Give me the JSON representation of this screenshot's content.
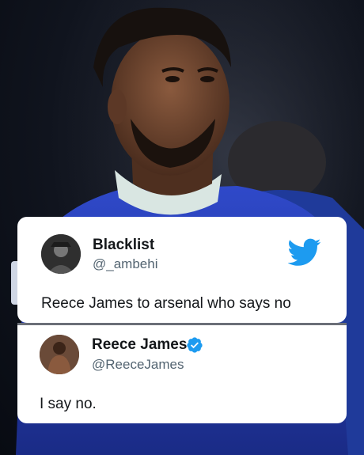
{
  "background_photo": {
    "description_icon": "footballer-photo"
  },
  "tweet": {
    "user_name": "Blacklist",
    "user_handle": "@_ambehi",
    "text": "Reece James to arsenal who says no",
    "logo_icon": "twitter-bird-icon"
  },
  "reply": {
    "user_name": "Reece James",
    "user_handle": "@ReeceJames",
    "verified_icon": "verified-badge-icon",
    "text": "I say no."
  },
  "colors": {
    "twitter_blue": "#1d9bf0",
    "card_background": "#ffffff",
    "handle_gray": "#536471",
    "text_dark": "#14171a"
  }
}
